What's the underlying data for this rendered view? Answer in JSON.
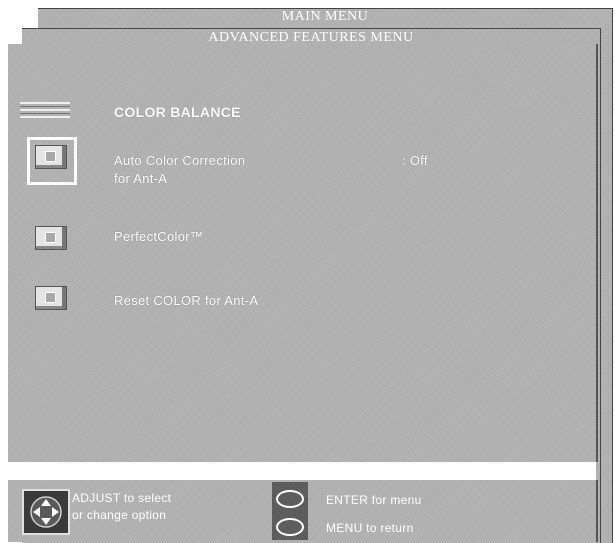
{
  "main_menu": {
    "title": "MAIN MENU"
  },
  "advanced_menu": {
    "title": "ADVANCED FEATURES MENU"
  },
  "section": {
    "title": "COLOR BALANCE"
  },
  "items": [
    {
      "label_line1": "Auto Color Correction",
      "label_line2": "for Ant-A",
      "value": ": Off",
      "selected": true
    },
    {
      "label": "PerfectColor™"
    },
    {
      "label": "Reset COLOR for Ant-A"
    }
  ],
  "footer": {
    "adjust_line1": "ADJUST to select",
    "adjust_line2": "or change option",
    "enter_hint": "ENTER for menu",
    "menu_hint": "MENU to return"
  },
  "icons": {
    "section": "color-balance-icon",
    "item": "menu-item-icon",
    "adjust": "directional-pad-icon",
    "buttons": "oval-button-icon"
  }
}
